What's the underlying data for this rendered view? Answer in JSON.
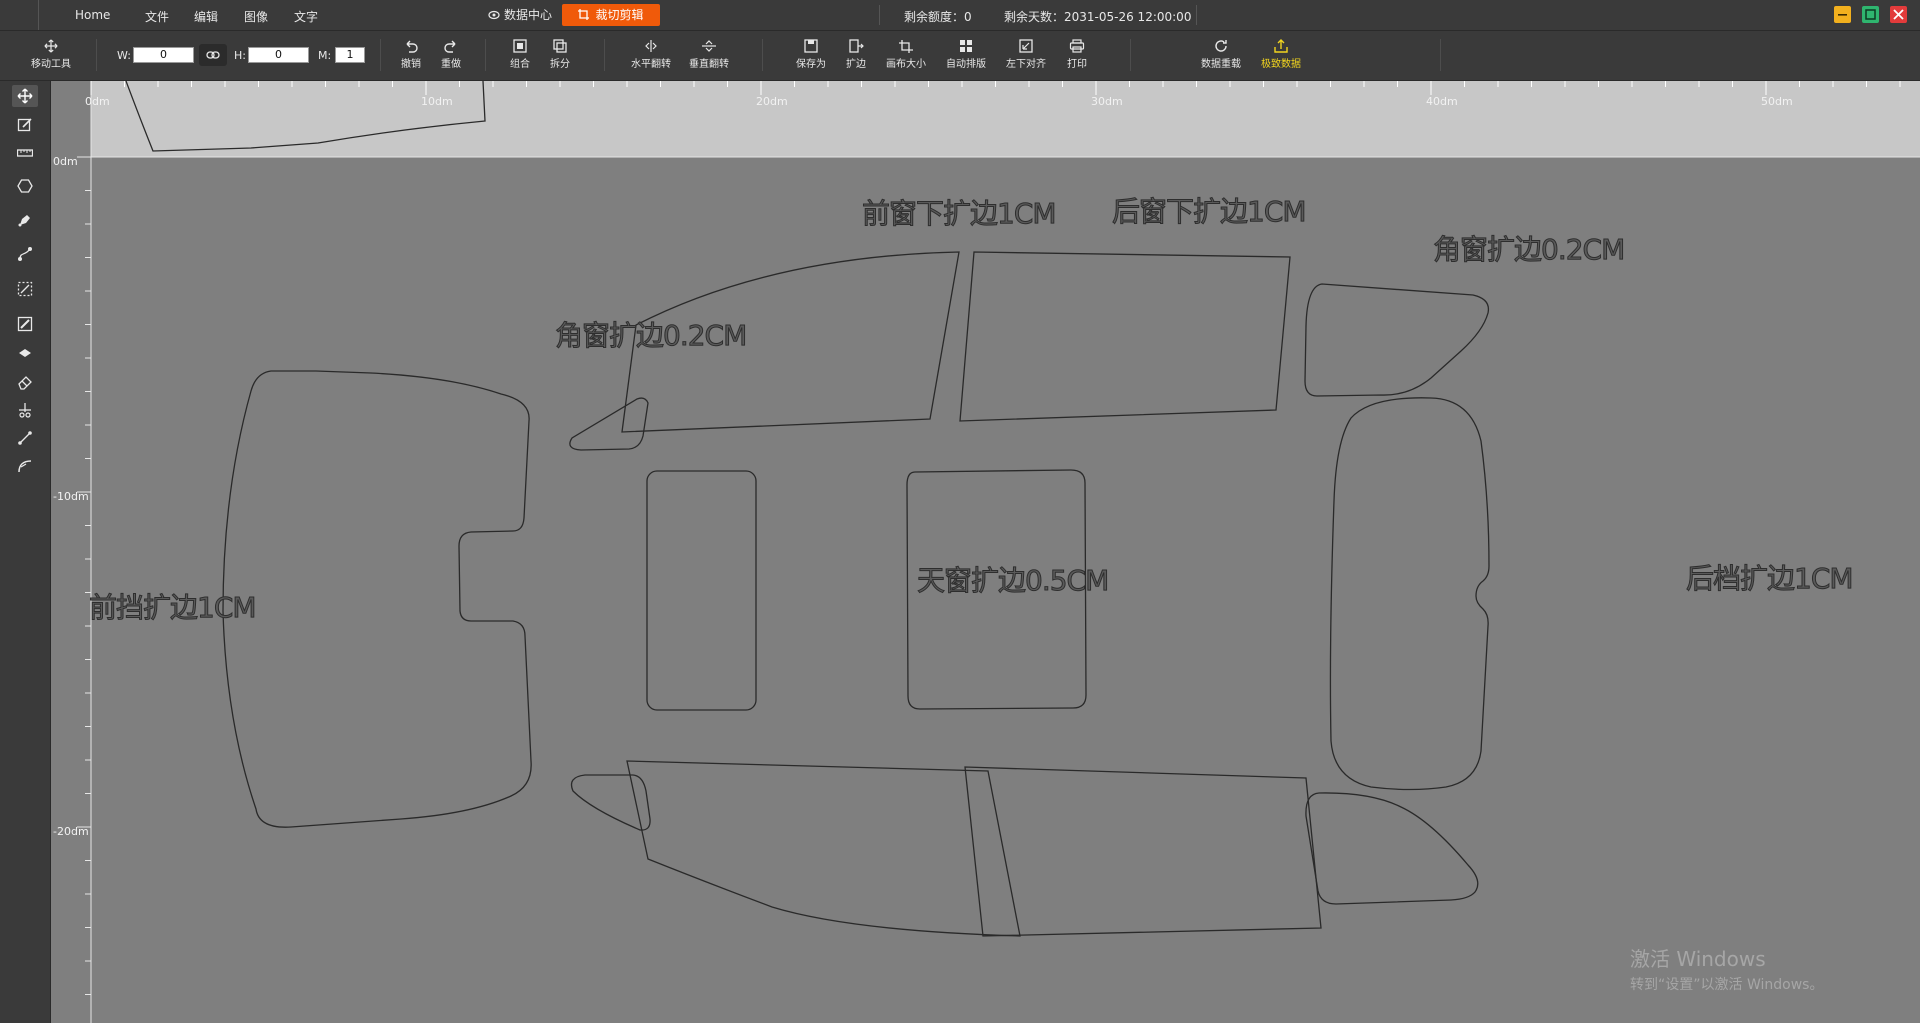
{
  "menubar": {
    "items": [
      "Home",
      "文件",
      "编辑",
      "图像",
      "文字"
    ],
    "tab_data_center": "数据中心",
    "tab_cut_edit": "裁切剪辑",
    "quota_remaining": "剩余额度：0",
    "days_remaining": "剩余天数：2031-05-26 12:00:00"
  },
  "toolbar": {
    "move_tool": "移动工具",
    "width_label": "W:",
    "width_value": "0",
    "height_label": "H:",
    "height_value": "0",
    "m_label": "M:",
    "m_value": "1",
    "undo": "撤销",
    "redo": "重做",
    "combine": "组合",
    "split": "拆分",
    "flip_h": "水平翻转",
    "flip_v": "垂直翻转",
    "save_as": "保存为",
    "expand": "扩边",
    "canvas_size": "画布大小",
    "auto_layout": "自动排版",
    "align_vertical": "左下对齐",
    "print": "打印",
    "data_reload": "数据重载",
    "export_data": "极致数据"
  },
  "ruler": {
    "h_labels": [
      "0dm",
      "10dm",
      "20dm",
      "30dm",
      "40dm",
      "50dm"
    ],
    "v_labels": [
      "0dm",
      "-10dm",
      "-20dm"
    ]
  },
  "pieces": {
    "front_window_label": "前窗下扩边1CM",
    "rear_window_label": "后窗下扩边1CM",
    "corner_window_left_label": "角窗扩边0.2CM",
    "corner_window_right_label": "角窗扩边0.2CM",
    "front_windshield_label": "前挡扩边1CM",
    "sunroof_label": "天窗扩边0.5CM",
    "rear_windshield_label": "后档扩边1CM"
  },
  "watermark": {
    "line1": "激活 Windows",
    "line2": "转到“设置”以激活 Windows。"
  },
  "colors": {
    "accent": "#f05a0a",
    "highlight": "#f2d51f",
    "canvas": "#7f7f7f",
    "ruler": "#c7c7c7"
  }
}
